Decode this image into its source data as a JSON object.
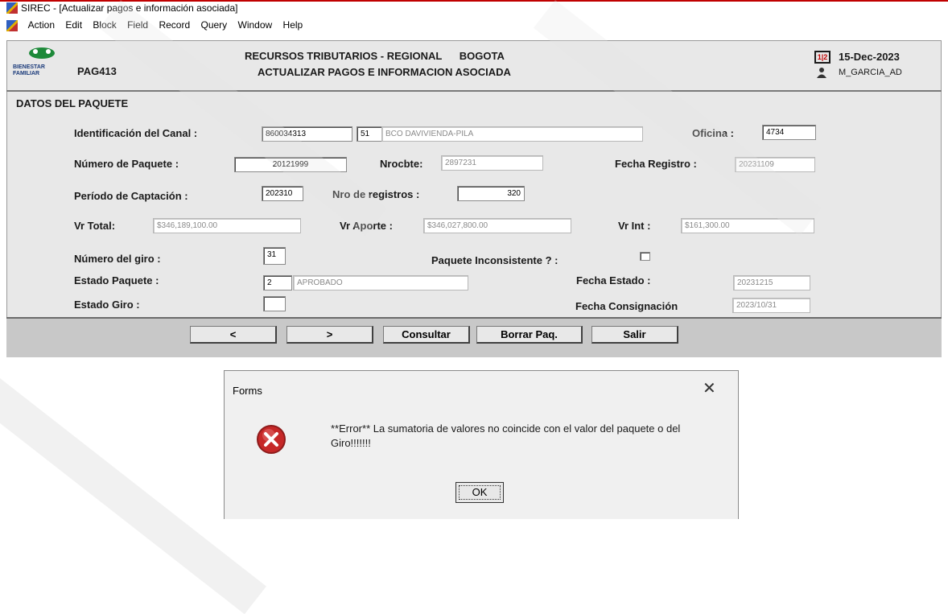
{
  "window": {
    "title": "SIREC - [Actualizar pagos e información asociada]"
  },
  "menu": [
    "Action",
    "Edit",
    "Block",
    "Field",
    "Record",
    "Query",
    "Window",
    "Help"
  ],
  "header": {
    "logo_text": "BIENESTAR FAMILIAR",
    "form_code": "PAG413",
    "title_line1": "RECURSOS TRIBUTARIOS - REGIONAL      BOGOTA",
    "title_line2": "ACTUALIZAR PAGOS E INFORMACION ASOCIADA",
    "date": "15-Dec-2023",
    "user": "M_GARCIA_AD"
  },
  "section_title": "DATOS DEL PAQUETE",
  "fields": {
    "canal_label": "Identificación del Canal :",
    "canal_nit": "860034313",
    "canal_code": "51",
    "canal_name": "BCO DAVIVIENDA-PILA",
    "oficina_label": "Oficina :",
    "oficina": "4734",
    "paquete_label": "Número de Paquete :",
    "paquete": "20121999",
    "nrocbte_label": "Nrocbte:",
    "nrocbte": "2897231",
    "fecha_registro_label": "Fecha Registro :",
    "fecha_registro": "20231109",
    "periodo_label": "Período de Captación :",
    "periodo": "202310",
    "nro_registros_label": "Nro de registros :",
    "nro_registros": "320",
    "vr_total_label": "Vr Total:",
    "vr_total": "$346,189,100.00",
    "vr_aporte_label": "Vr Aporte :",
    "vr_aporte": "$346,027,800.00",
    "vr_int_label": "Vr Int :",
    "vr_int": "$161,300.00",
    "giro_label": "Número del giro :",
    "giro": "31",
    "inconsistente_label": "Paquete Inconsistente ? :",
    "estado_paquete_label": "Estado Paquete :",
    "estado_code": "2",
    "estado_text": "APROBADO",
    "fecha_estado_label": "Fecha Estado :",
    "fecha_estado": "20231215",
    "estado_giro_label": "Estado Giro :",
    "estado_giro": "",
    "fecha_consig_label": "Fecha Consignación",
    "fecha_consig": "2023/10/31"
  },
  "buttons": {
    "prev": "<",
    "next": ">",
    "consultar": "Consultar",
    "borrar": "Borrar Paq.",
    "salir": "Salir"
  },
  "dialog": {
    "title": "Forms",
    "close": "✕",
    "message": "**Error** La sumatoria de valores no coincide con el valor del paquete o del Giro!!!!!!!",
    "ok": "OK"
  },
  "colors": {
    "form_bg": "#e8e8e8",
    "button_bar": "#c8c8c8",
    "error_red": "#d32f2f"
  }
}
